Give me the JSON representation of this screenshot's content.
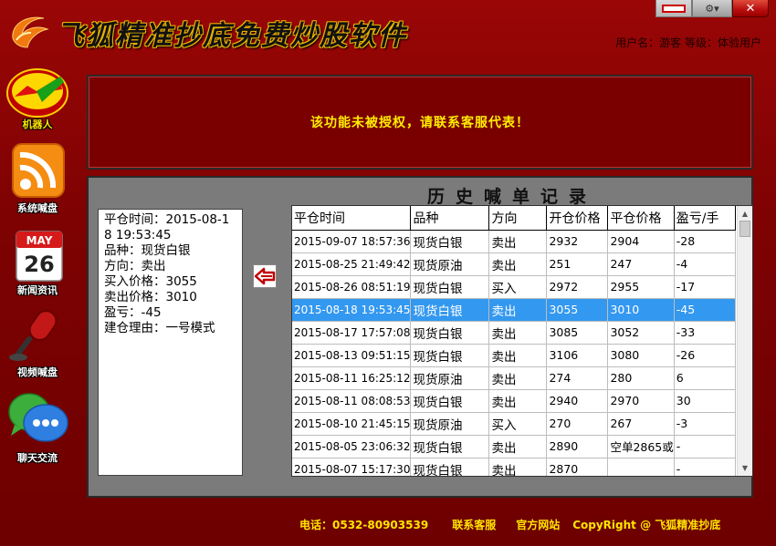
{
  "app": {
    "title": "飞狐精准抄底免费炒股软件",
    "user_info": "用户名：游客 等级：体验用户",
    "window_controls": {
      "close": "✕",
      "options": "⚙▾"
    }
  },
  "sidebar": {
    "items": [
      {
        "label": "机器人",
        "icon": "robot-chart-icon",
        "active": true
      },
      {
        "label": "系统喊盘",
        "icon": "rss-feed-icon",
        "active": false
      },
      {
        "label": "新闻资讯",
        "icon": "calendar-icon",
        "calendar_month": "MAY",
        "calendar_day": "26",
        "active": false
      },
      {
        "label": "视频喊盘",
        "icon": "microphone-icon",
        "active": false
      },
      {
        "label": "聊天交流",
        "icon": "chat-bubbles-icon",
        "active": false
      }
    ]
  },
  "notice": {
    "text": "该功能未被授权，请联系客服代表！"
  },
  "history": {
    "title": "历史喊单记录",
    "detail": {
      "close_time": "平仓时间：2015-08-18 19:53:45",
      "product": "品种：现货白银",
      "direction": "方向：卖出",
      "buy_price": "买入价格：3055",
      "sell_price": "卖出价格：3010",
      "pnl": "盈亏：-45",
      "reason": "建仓理由：一号模式"
    },
    "columns": [
      "平仓时间",
      "品种",
      "方向",
      "开仓价格",
      "平仓价格",
      "盈亏/手"
    ],
    "rows": [
      [
        "2015-09-07 18:57:36",
        "现货白银",
        "卖出",
        "2932",
        "2904",
        "-28"
      ],
      [
        "2015-08-25 21:49:42",
        "现货原油",
        "卖出",
        "251",
        "247",
        "-4"
      ],
      [
        "2015-08-26 08:51:19",
        "现货白银",
        "买入",
        "2972",
        "2955",
        "-17"
      ],
      [
        "2015-08-18 19:53:45",
        "现货白银",
        "卖出",
        "3055",
        "3010",
        "-45"
      ],
      [
        "2015-08-17 17:57:08",
        "现货白银",
        "卖出",
        "3085",
        "3052",
        "-33"
      ],
      [
        "2015-08-13 09:51:15",
        "现货白银",
        "卖出",
        "3106",
        "3080",
        "-26"
      ],
      [
        "2015-08-11 16:25:12",
        "现货原油",
        "卖出",
        "274",
        "280",
        "6"
      ],
      [
        "2015-08-11 08:08:53",
        "现货白银",
        "卖出",
        "2940",
        "2970",
        "30"
      ],
      [
        "2015-08-10 21:45:15",
        "现货原油",
        "买入",
        "270",
        "267",
        "-3"
      ],
      [
        "2015-08-05 23:06:32",
        "现货白银",
        "卖出",
        "2890",
        "空单2865或",
        "-"
      ],
      [
        "2015-08-07 15:17:30",
        "现货白银",
        "卖出",
        "2870",
        "",
        "-"
      ]
    ],
    "selected_row": 3
  },
  "footer": {
    "phone": "电话：0532-80903539",
    "contact": "联系客服",
    "website": "官方网站",
    "copyright": "CopyRight @ 飞狐精准抄底"
  },
  "colors": {
    "background": "#7e0202",
    "notice_text": "#ffee00",
    "footer_text": "#ffe500",
    "selected_row": "#3398f0"
  }
}
